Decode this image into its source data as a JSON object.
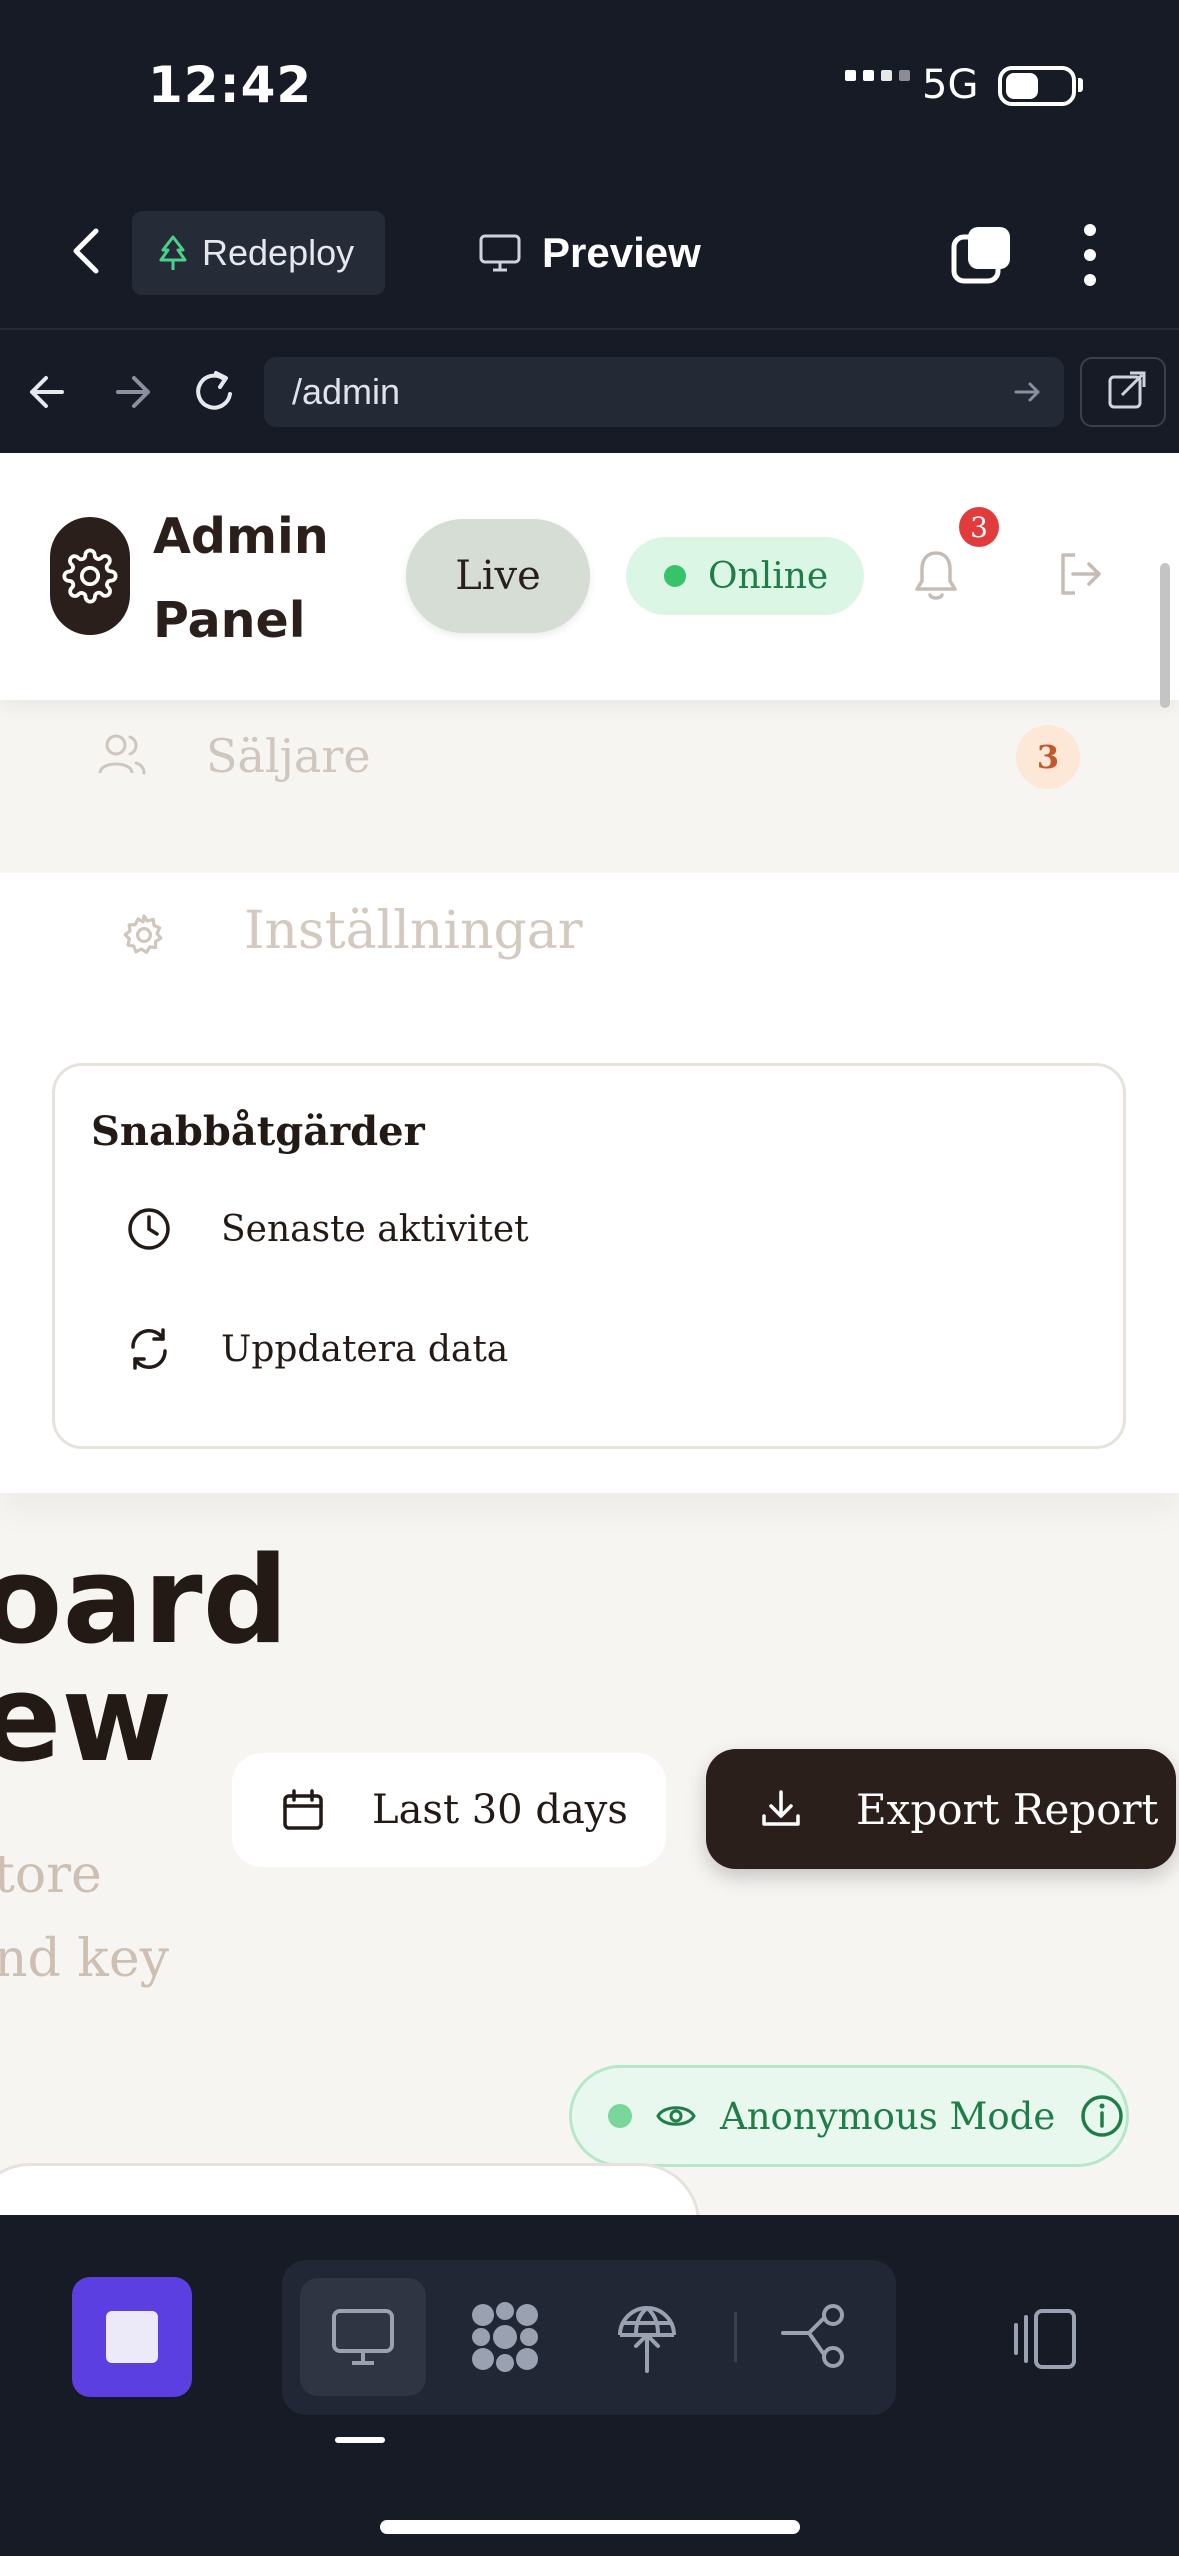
{
  "status_bar": {
    "time": "12:42",
    "network": "5G"
  },
  "app_bar": {
    "redeploy_label": "Redeploy",
    "preview_label": "Preview"
  },
  "url_bar": {
    "url": "/admin"
  },
  "header": {
    "brand_line1": "Admin",
    "brand_line2": "Panel",
    "live_label": "Live",
    "online_label": "Online",
    "notifications_count": "3"
  },
  "nav": {
    "sellers_label": "Säljare",
    "sellers_count": "3",
    "settings_label": "Inställningar"
  },
  "quick_actions": {
    "title": "Snabbåtgärder",
    "items": [
      {
        "label": "Senaste aktivitet",
        "icon": "clock-icon"
      },
      {
        "label": "Uppdatera data",
        "icon": "refresh-icon"
      }
    ]
  },
  "dashboard": {
    "title_line1": "oard",
    "title_line2": "ew",
    "subtitle_line1": "tore",
    "subtitle_line2": "nd key",
    "range_label": "Last 30 days",
    "export_label": "Export Report",
    "anon_label": "Anonymous Mode"
  },
  "colors": {
    "accent": "#5b3fe0",
    "brand_dark": "#2a1f1b",
    "online_green": "#1f7d48",
    "badge_red": "#e23b3b"
  }
}
